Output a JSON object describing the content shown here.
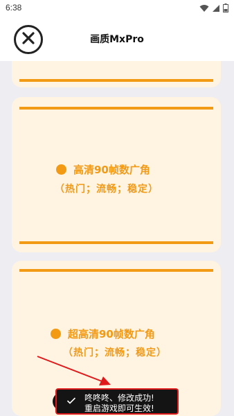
{
  "status_bar": {
    "time": "6:38",
    "icons": [
      "wifi-icon",
      "signal-icon",
      "battery-icon"
    ]
  },
  "header": {
    "title": "画质MxPro",
    "close_icon": "close-icon"
  },
  "options": [
    {
      "title": "高清90帧数广角",
      "subtitle": "（热门；流畅；稳定）"
    },
    {
      "title": "超高清90帧数广角",
      "subtitle": "（热门；流畅；稳定）"
    }
  ],
  "toast": {
    "line1": "咚咚咚、修改成功!",
    "line2": "重启游戏即可生效!"
  },
  "colors": {
    "accent": "#f29a14",
    "card_bg": "#fff3e2",
    "page_bg": "#eeeef2",
    "annotation": "#e0191b"
  }
}
